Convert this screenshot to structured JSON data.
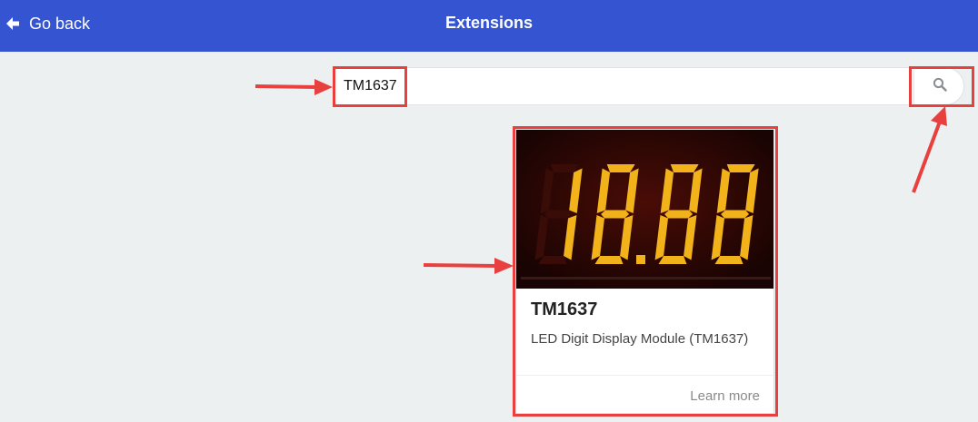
{
  "header": {
    "back_label": "Go back",
    "title": "Extensions"
  },
  "search": {
    "value": "TM1637",
    "button_icon": "search-icon"
  },
  "card": {
    "display_digits": "18.88",
    "name": "TM1637",
    "description": "LED Digit Display Module (TM1637)",
    "learn_more": "Learn more"
  },
  "colors": {
    "topbar": "#3454d1",
    "background": "#ecf0f1",
    "annotation": "#e8403f",
    "segment_on": "#f2b21a"
  }
}
